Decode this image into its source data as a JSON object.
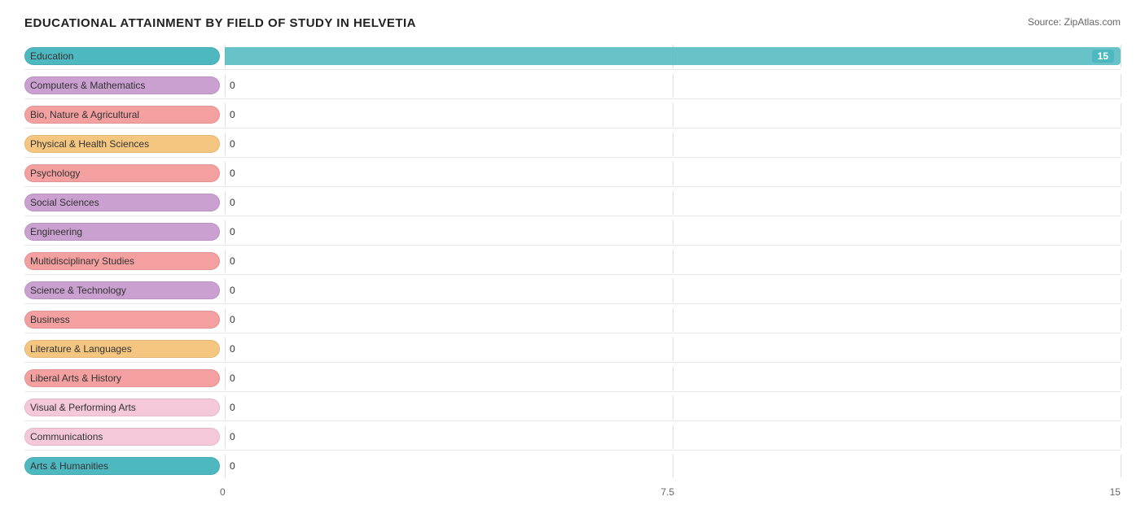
{
  "title": "EDUCATIONAL ATTAINMENT BY FIELD OF STUDY IN HELVETIA",
  "source": "Source: ZipAtlas.com",
  "chart": {
    "max_value": 15,
    "mid_value": 7.5,
    "min_value": 0,
    "bars": [
      {
        "label": "Education",
        "value": 15,
        "color": "#4db8c0",
        "label_bg": "#4db8c0",
        "is_max": true
      },
      {
        "label": "Computers & Mathematics",
        "value": 0,
        "color": "#c9a0d0",
        "label_bg": "#c9a0d0"
      },
      {
        "label": "Bio, Nature & Agricultural",
        "value": 0,
        "color": "#f4a0a0",
        "label_bg": "#f4a0a0"
      },
      {
        "label": "Physical & Health Sciences",
        "value": 0,
        "color": "#f5c680",
        "label_bg": "#f5c680"
      },
      {
        "label": "Psychology",
        "value": 0,
        "color": "#f4a0a0",
        "label_bg": "#f4a0a0"
      },
      {
        "label": "Social Sciences",
        "value": 0,
        "color": "#c9a0d0",
        "label_bg": "#c9a0d0"
      },
      {
        "label": "Engineering",
        "value": 0,
        "color": "#c9a0d0",
        "label_bg": "#c9a0d0"
      },
      {
        "label": "Multidisciplinary Studies",
        "value": 0,
        "color": "#f4a0a0",
        "label_bg": "#f4a0a0"
      },
      {
        "label": "Science & Technology",
        "value": 0,
        "color": "#c9a0d0",
        "label_bg": "#c9a0d0"
      },
      {
        "label": "Business",
        "value": 0,
        "color": "#f4a0a0",
        "label_bg": "#f4a0a0"
      },
      {
        "label": "Literature & Languages",
        "value": 0,
        "color": "#f5c680",
        "label_bg": "#f5c680"
      },
      {
        "label": "Liberal Arts & History",
        "value": 0,
        "color": "#f4a0a0",
        "label_bg": "#f4a0a0"
      },
      {
        "label": "Visual & Performing Arts",
        "value": 0,
        "color": "#f4c8d8",
        "label_bg": "#f4c8d8"
      },
      {
        "label": "Communications",
        "value": 0,
        "color": "#f4c8d8",
        "label_bg": "#f4c8d8"
      },
      {
        "label": "Arts & Humanities",
        "value": 0,
        "color": "#4db8c0",
        "label_bg": "#4db8c0"
      }
    ]
  },
  "x_axis": {
    "labels": [
      "0",
      "7.5",
      "15"
    ]
  }
}
